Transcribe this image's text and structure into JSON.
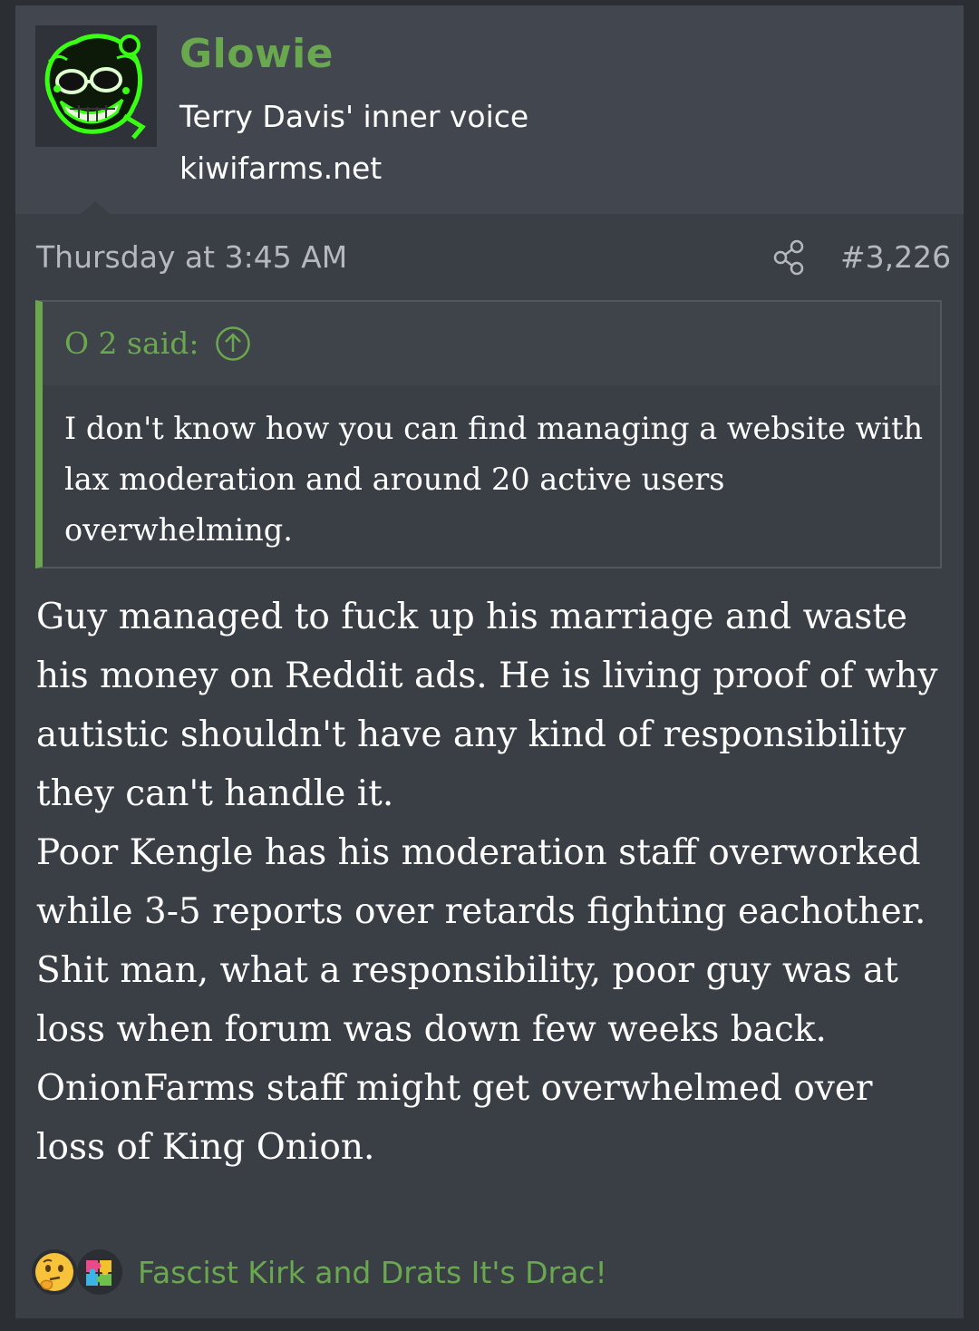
{
  "user": {
    "name": "Glowie",
    "title": "Terry Davis' inner voice",
    "banner": "kiwifarms.net",
    "avatar_icon": "glowie-avatar-icon"
  },
  "meta": {
    "date": "Thursday at 3:45 AM",
    "post_number": "#3,226",
    "share_icon": "share-icon"
  },
  "quote": {
    "author_label": "O 2 said:",
    "expand_icon": "arrow-up-circle-icon",
    "text": "I don't know how you can find managing a website with lax moderation and around 20 active users overwhelming."
  },
  "message": {
    "text": "Guy managed to fuck up his marriage and waste his money on Reddit ads. He is living proof of why autistic shouldn't have any kind of responsibility they can't handle it.\nPoor Kengle has his moderation staff overworked while 3-5 reports over retards fighting eachother. Shit man, what a responsibility, poor guy was at loss when forum was down few weeks back. OnionFarms staff might get overwhelmed over loss of King Onion."
  },
  "reactions": {
    "icons": [
      "thinking-face-icon",
      "puzzle-piece-icon"
    ],
    "names": "Fascist Kirk and Drats It's Drac!"
  },
  "colors": {
    "accent": "#6aa84f",
    "background": "#2b2e33",
    "post_bg": "#3a3e45",
    "header_bg": "#42464e"
  }
}
